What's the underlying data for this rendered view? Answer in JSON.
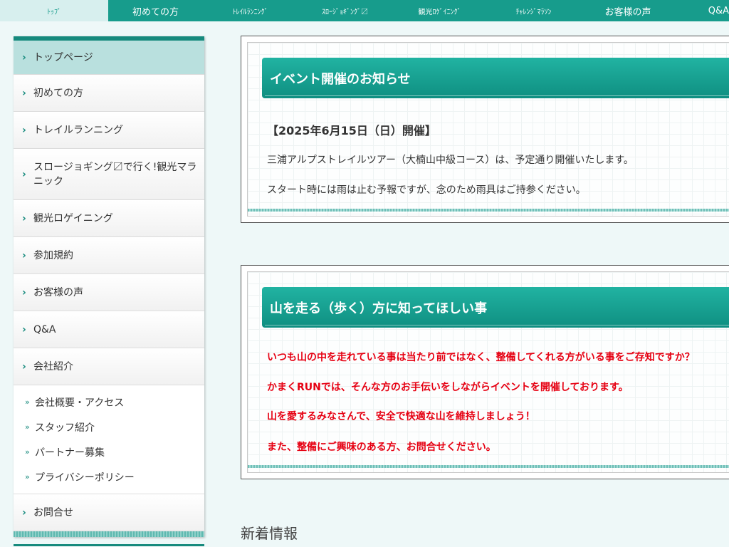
{
  "topnav": {
    "items": [
      {
        "label": "ﾄｯﾌﾟ",
        "small": true,
        "active": true
      },
      {
        "label": "初めての方",
        "small": false,
        "active": false
      },
      {
        "label": "ﾄﾚｲﾙﾗﾝﾆﾝｸﾞ",
        "small": true,
        "active": false
      },
      {
        "label": "ｽﾛｰｼﾞｮｷﾞﾝｸﾞ〼",
        "small": true,
        "active": false
      },
      {
        "label": "観光ﾛｹﾞｲﾆﾝｸﾞ",
        "small": true,
        "active": false
      },
      {
        "label": "ﾁｬﾚﾝｼﾞﾏﾗｿﾝ",
        "small": true,
        "active": false
      },
      {
        "label": "お客様の声",
        "small": false,
        "active": false
      },
      {
        "label": "Q&A",
        "small": false,
        "active": false
      }
    ]
  },
  "sidebar": {
    "items": [
      {
        "label": "トップページ"
      },
      {
        "label": "初めての方"
      },
      {
        "label": "トレイルランニング"
      },
      {
        "label": "スロージョギング〼で行く!観光マラニック"
      },
      {
        "label": "観光ロゲイニング"
      },
      {
        "label": "参加規約"
      },
      {
        "label": "お客様の声"
      },
      {
        "label": "Q&A"
      },
      {
        "label": "会社紹介"
      }
    ],
    "subitems": [
      {
        "label": "会社概要・アクセス"
      },
      {
        "label": "スタッフ紹介"
      },
      {
        "label": "パートナー募集"
      },
      {
        "label": "プライバシーポリシー"
      }
    ],
    "contact": {
      "label": "お問合せ"
    }
  },
  "event_notice": {
    "title": "イベント開催のお知らせ",
    "date": "【2025年6月15日（日）開催】",
    "line1": "三浦アルプストレイルツアー（大楠山中級コース）は、予定通り開催いたします。",
    "line2": "スタート時には雨は止む予報ですが、念のため雨具はご持参ください。"
  },
  "mountain_notice": {
    "title": "山を走る（歩く）方に知ってほしい事",
    "lines": [
      "いつも山の中を走れている事は当たり前ではなく、整備してくれる方がいる事をご存知ですか？",
      "かまくRUNでは、そんな方のお手伝いをしながらイベントを開催しております。",
      "山を愛するみなさんで、安全で快適な山を維持しましょう！",
      "また、整備にご興味のある方、お問合せください。"
    ]
  },
  "news": {
    "title": "新着情報"
  },
  "colors": {
    "brand": "#179c8c",
    "accent_red": "#e60012"
  }
}
